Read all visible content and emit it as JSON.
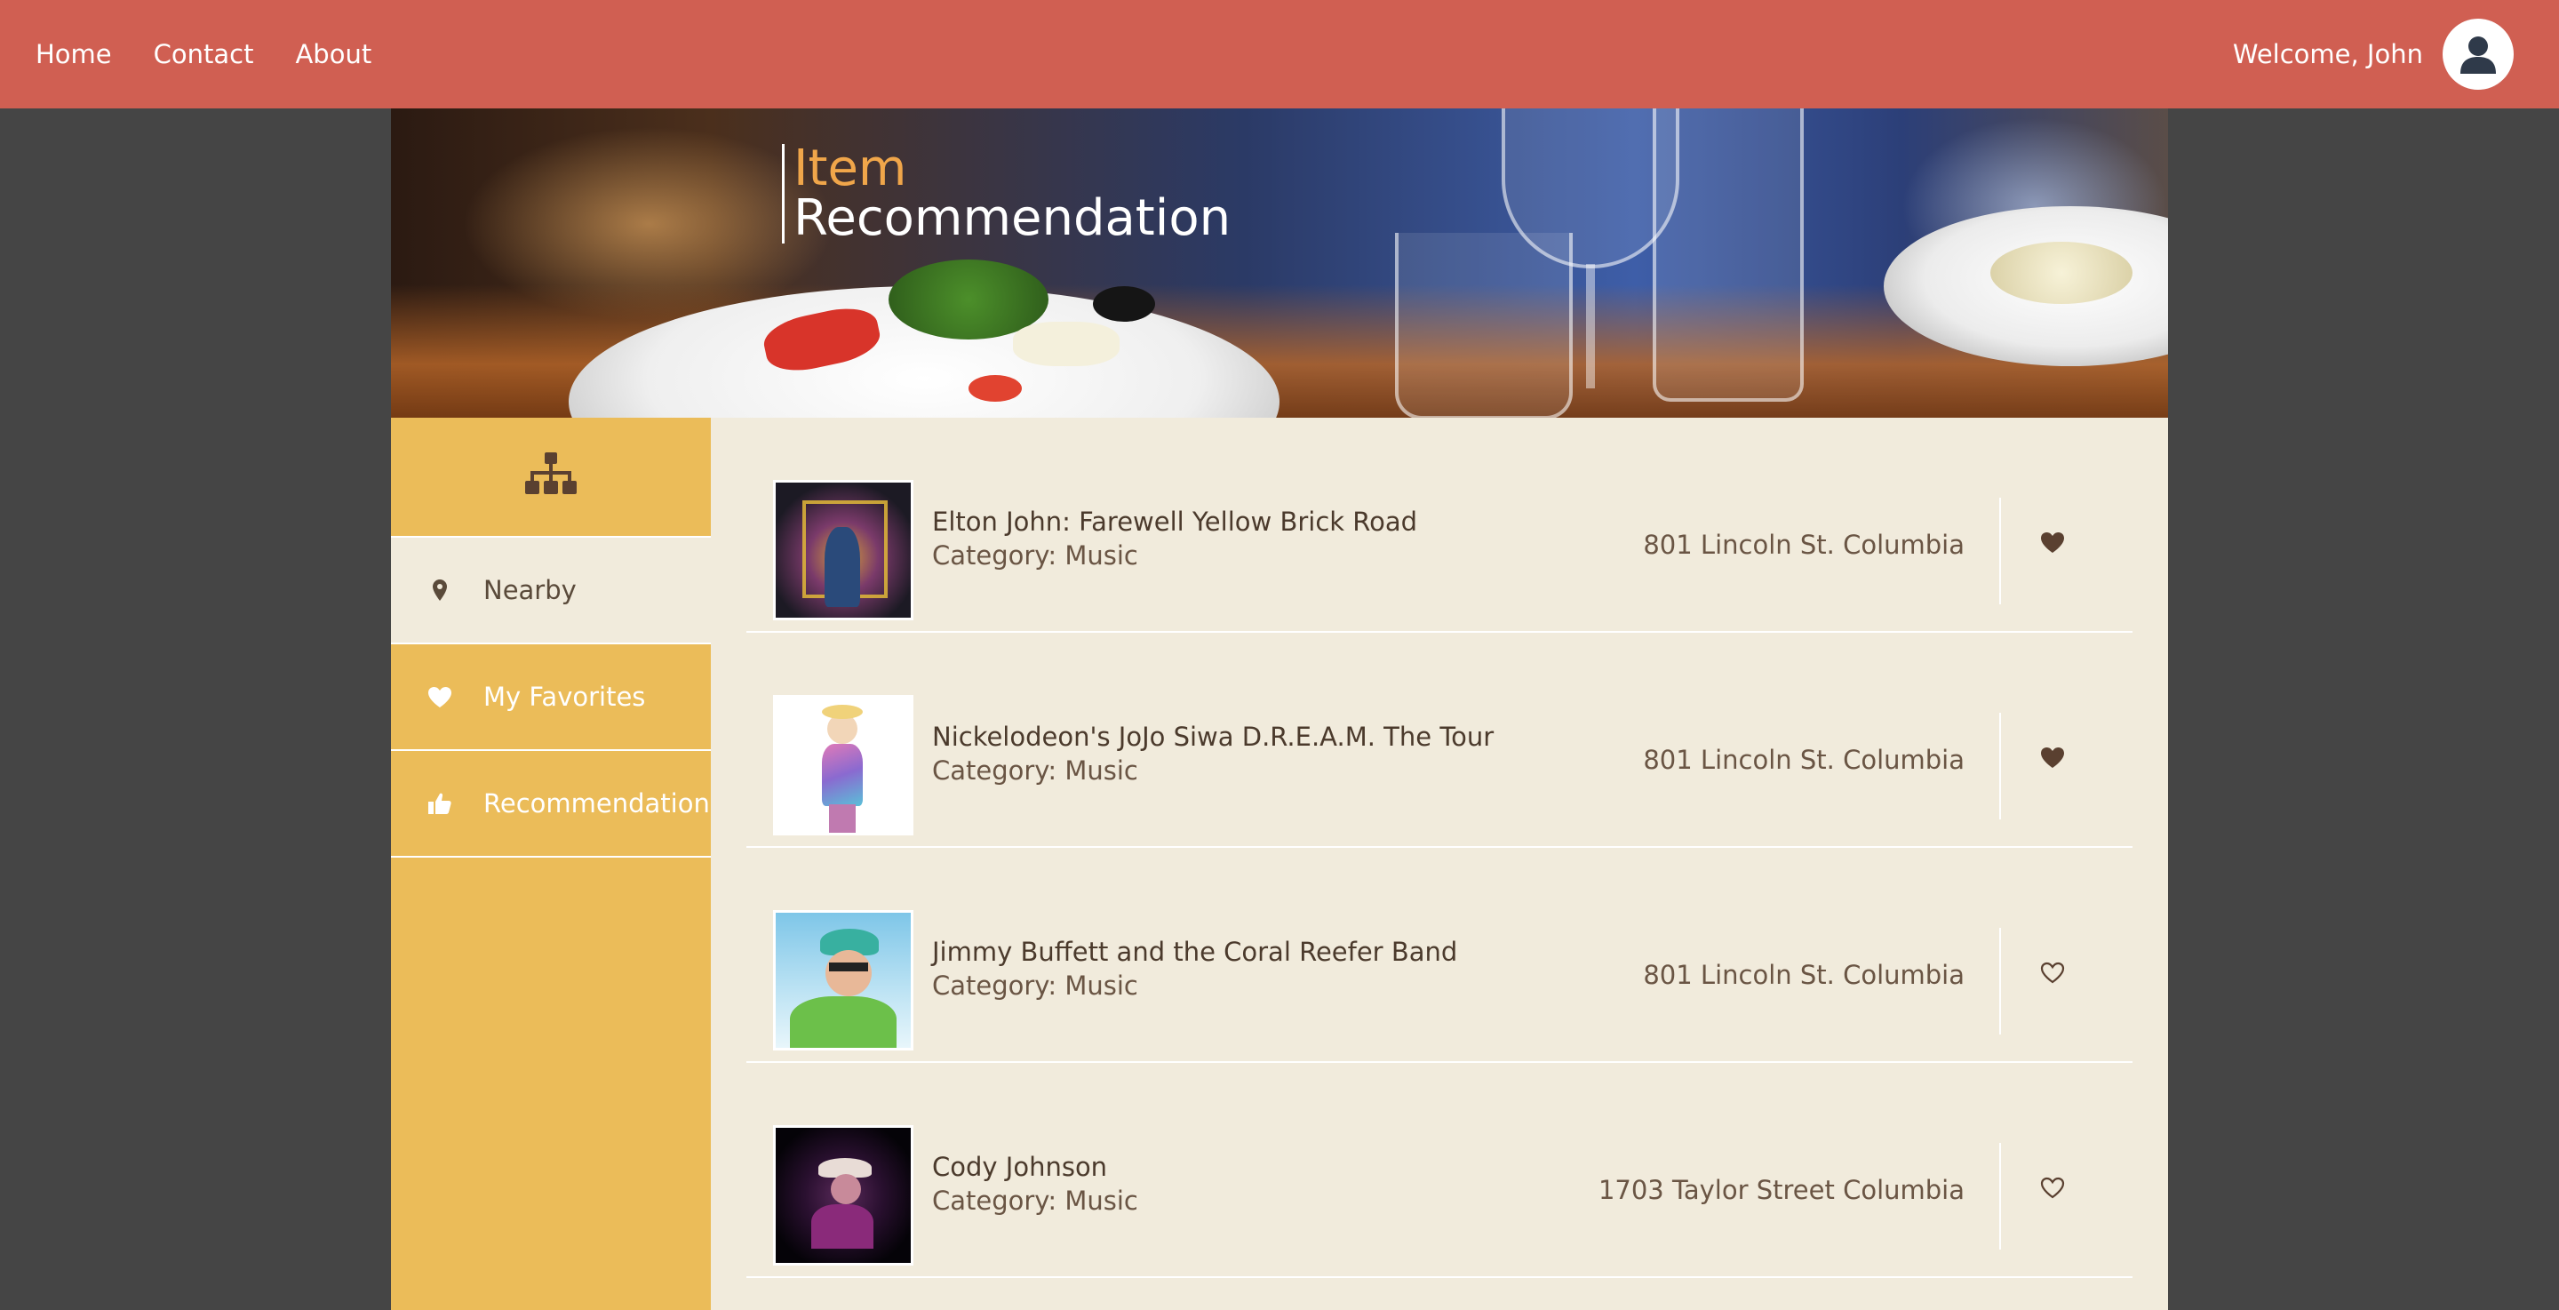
{
  "nav": {
    "links": [
      "Home",
      "Contact",
      "About"
    ],
    "welcome": "Welcome, John",
    "avatar_icon": "user-circle-icon"
  },
  "banner": {
    "title_line1": "Item",
    "title_line2": "Recommendation"
  },
  "sidebar": {
    "top_icon": "sitemap-icon",
    "items": [
      {
        "label": "Nearby",
        "icon": "map-marker-icon",
        "active": true
      },
      {
        "label": "My Favorites",
        "icon": "heart-icon",
        "active": false
      },
      {
        "label": "Recommendation",
        "icon": "thumbs-up-icon",
        "active": false
      }
    ]
  },
  "items": [
    {
      "name": "Elton John: Farewell Yellow Brick Road",
      "category": "Category: Music",
      "address": "801 Lincoln St. Columbia",
      "favorite": true
    },
    {
      "name": "Nickelodeon's JoJo Siwa D.R.E.A.M. The Tour",
      "category": "Category: Music",
      "address": "801 Lincoln St. Columbia",
      "favorite": true
    },
    {
      "name": "Jimmy Buffett and the Coral Reefer Band",
      "category": "Category: Music",
      "address": "801 Lincoln St. Columbia",
      "favorite": false
    },
    {
      "name": "Cody Johnson",
      "category": "Category: Music",
      "address": "1703 Taylor Street Columbia",
      "favorite": false
    }
  ],
  "colors": {
    "nav_bg": "#d05f52",
    "sidebar_bg": "#ebbc59",
    "content_bg": "#f1ebdc",
    "accent_orange": "#f0a64a",
    "text_dark": "#4b3a2c"
  }
}
